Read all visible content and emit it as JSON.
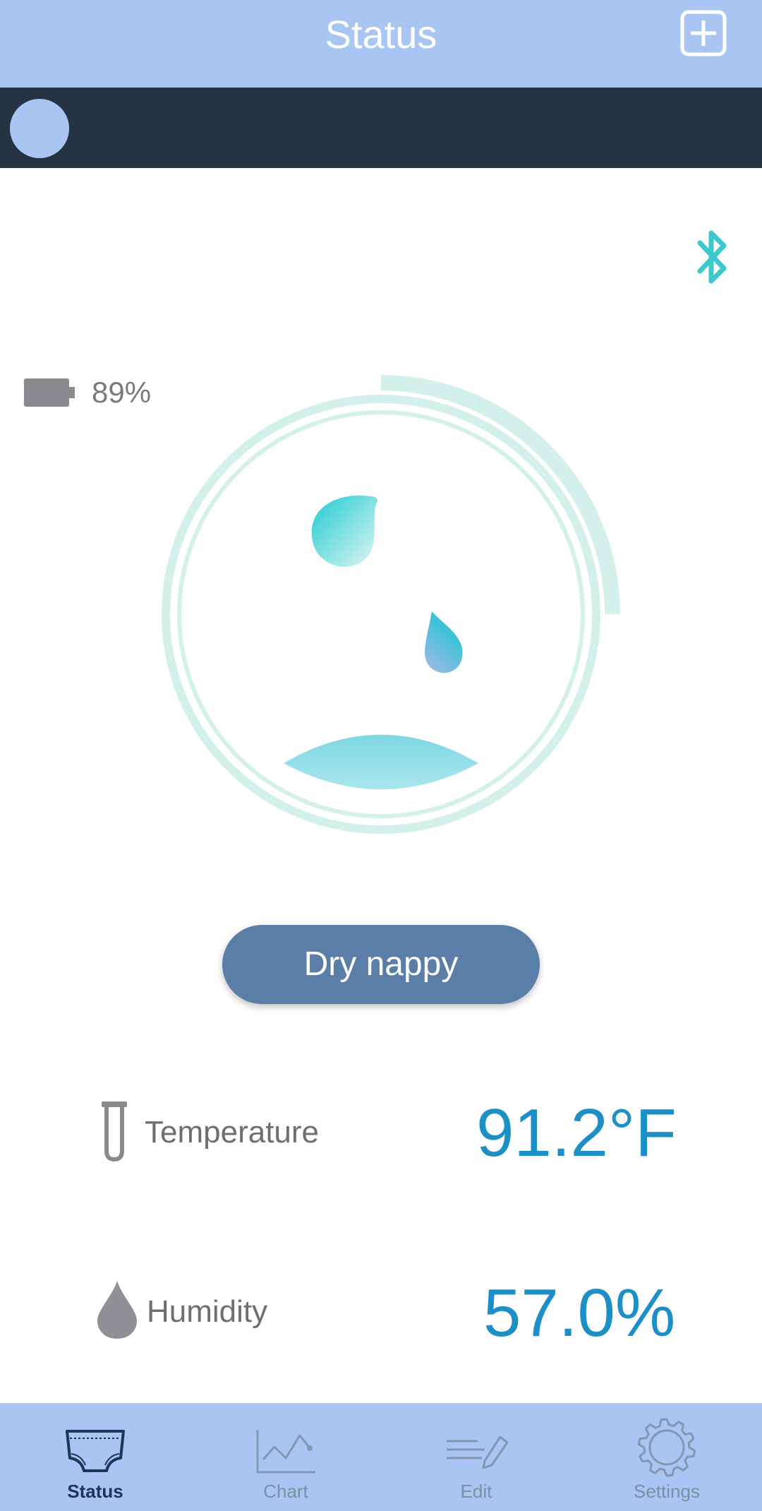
{
  "header": {
    "title": "Status",
    "add_icon": "plus-square-icon"
  },
  "profile": {
    "avatar_color": "#a9c5f2"
  },
  "status": {
    "bluetooth_icon": "bluetooth-icon",
    "battery_icon": "battery-icon",
    "battery_level": 0.89,
    "battery_text": "89%",
    "dial_progress_fraction": 0.25,
    "dry_button_label": "Dry nappy"
  },
  "readings": {
    "temperature_label": "Temperature",
    "temperature_value": "91.2°F",
    "humidity_label": "Humidity",
    "humidity_value": "57.0%"
  },
  "nav": {
    "items": [
      {
        "label": "Status",
        "icon": "diaper-icon",
        "active": true
      },
      {
        "label": "Chart",
        "icon": "line-chart-icon",
        "active": false
      },
      {
        "label": "Edit",
        "icon": "edit-icon",
        "active": false
      },
      {
        "label": "Settings",
        "icon": "gear-icon",
        "active": false
      }
    ]
  },
  "colors": {
    "header_bg": "#a9c5f2",
    "profile_bar_bg": "#253343",
    "accent_teal": "#3cc8cc",
    "value_blue": "#1c8fc6",
    "button_bg": "#5b7ea8",
    "ring": "#d3f1ea"
  }
}
